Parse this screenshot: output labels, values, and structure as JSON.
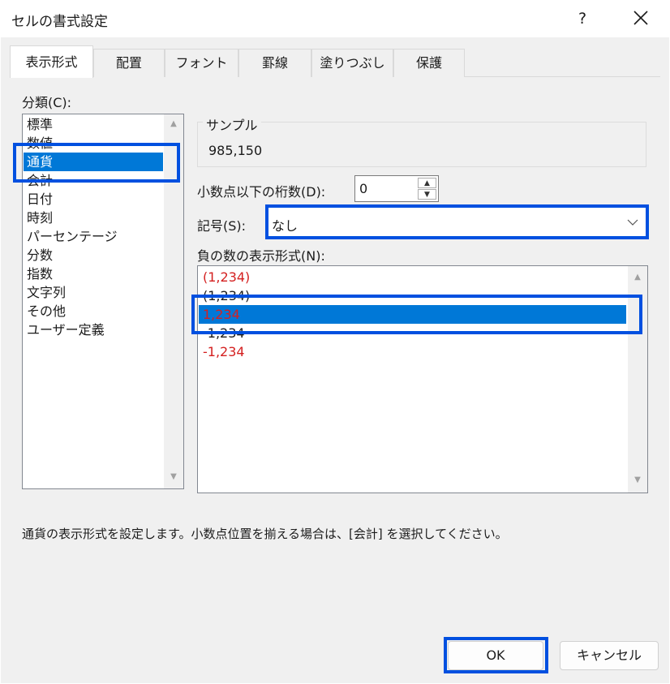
{
  "window": {
    "title": "セルの書式設定"
  },
  "tabs": [
    {
      "label": "表示形式"
    },
    {
      "label": "配置"
    },
    {
      "label": "フォント"
    },
    {
      "label": "罫線"
    },
    {
      "label": "塗りつぶし"
    },
    {
      "label": "保護"
    }
  ],
  "category": {
    "label": "分類(C):",
    "items": [
      "標準",
      "数値",
      "通貨",
      "会計",
      "日付",
      "時刻",
      "パーセンテージ",
      "分数",
      "指数",
      "文字列",
      "その他",
      "ユーザー定義"
    ],
    "selected": "通貨"
  },
  "sample": {
    "label": "サンプル",
    "value": "985,150"
  },
  "decimal_places": {
    "label": "小数点以下の桁数(D):",
    "value": "0"
  },
  "symbol": {
    "label": "記号(S):",
    "value": "なし"
  },
  "negative_format": {
    "label": "負の数の表示形式(N):",
    "items": [
      {
        "text": "(1,234)",
        "color": "#d42020"
      },
      {
        "text": "(1,234)",
        "color": "#1b1b1b"
      },
      {
        "text": "1,234",
        "color": "#d42020"
      },
      {
        "text": "-1,234",
        "color": "#1b1b1b"
      },
      {
        "text": "-1,234",
        "color": "#d42020"
      }
    ],
    "selected_index": 2
  },
  "description": "通貨の表示形式を設定します。小数点位置を揃える場合は、[会計] を選択してください。",
  "buttons": {
    "ok": "OK",
    "cancel": "キャンセル"
  },
  "colors": {
    "selection": "#0078d7",
    "highlight_border": "#0050e0",
    "negative_red": "#d42020"
  }
}
